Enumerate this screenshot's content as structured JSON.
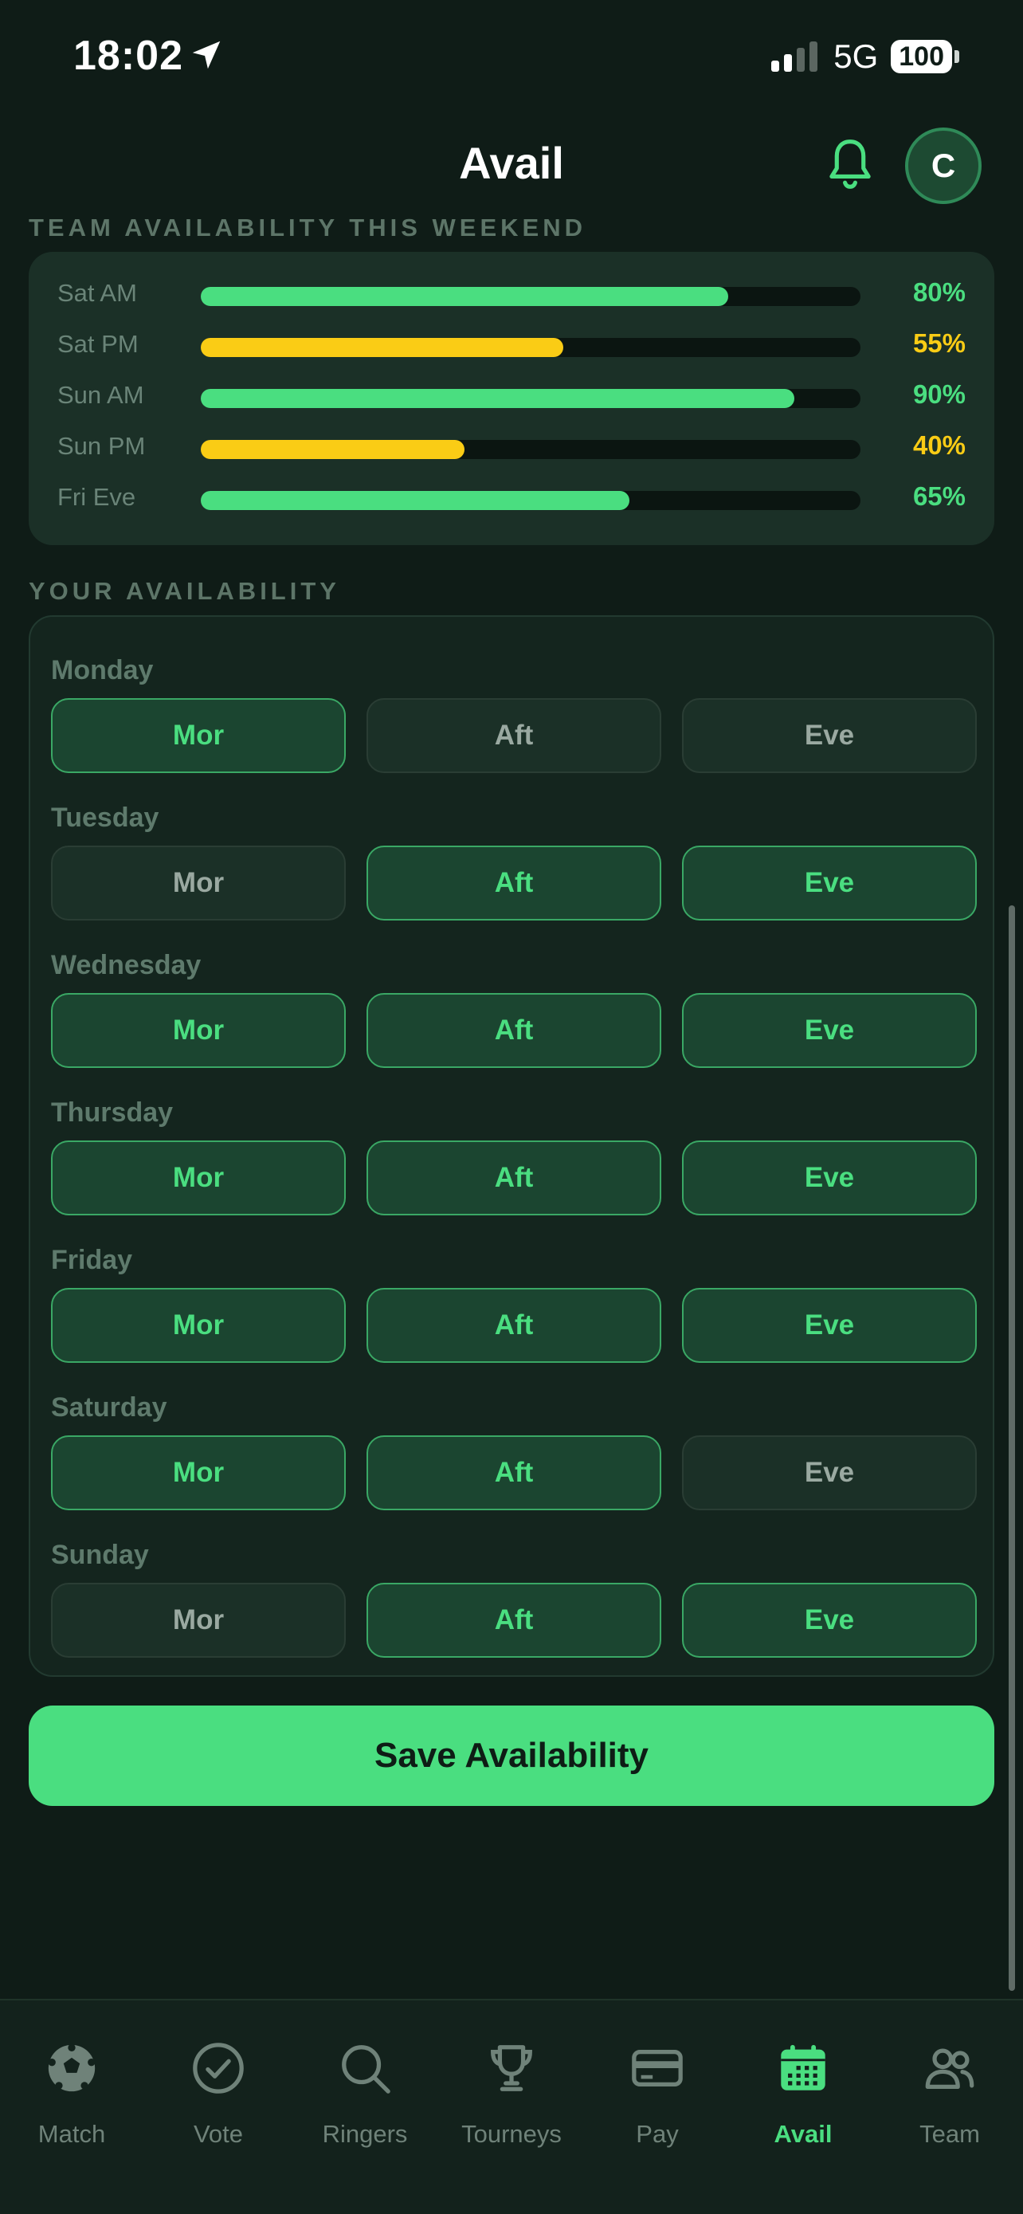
{
  "status_bar": {
    "time": "18:02",
    "network": "5G",
    "battery": "100"
  },
  "header": {
    "title": "Avail",
    "avatar_initial": "C"
  },
  "team_section": {
    "label": "TEAM AVAILABILITY THIS WEEKEND",
    "rows": [
      {
        "label": "Sat AM",
        "percent": 80,
        "percent_text": "80%",
        "color": "#4ade80"
      },
      {
        "label": "Sat PM",
        "percent": 55,
        "percent_text": "55%",
        "color": "#facc15"
      },
      {
        "label": "Sun AM",
        "percent": 90,
        "percent_text": "90%",
        "color": "#4ade80"
      },
      {
        "label": "Sun PM",
        "percent": 40,
        "percent_text": "40%",
        "color": "#facc15"
      },
      {
        "label": "Fri Eve",
        "percent": 65,
        "percent_text": "65%",
        "color": "#4ade80"
      }
    ]
  },
  "your_section": {
    "label": "YOUR AVAILABILITY",
    "days": [
      {
        "name": "Monday",
        "slots": [
          {
            "label": "Mor",
            "on": true
          },
          {
            "label": "Aft",
            "on": false
          },
          {
            "label": "Eve",
            "on": false
          }
        ]
      },
      {
        "name": "Tuesday",
        "slots": [
          {
            "label": "Mor",
            "on": false
          },
          {
            "label": "Aft",
            "on": true
          },
          {
            "label": "Eve",
            "on": true
          }
        ]
      },
      {
        "name": "Wednesday",
        "slots": [
          {
            "label": "Mor",
            "on": true
          },
          {
            "label": "Aft",
            "on": true
          },
          {
            "label": "Eve",
            "on": true
          }
        ]
      },
      {
        "name": "Thursday",
        "slots": [
          {
            "label": "Mor",
            "on": true
          },
          {
            "label": "Aft",
            "on": true
          },
          {
            "label": "Eve",
            "on": true
          }
        ]
      },
      {
        "name": "Friday",
        "slots": [
          {
            "label": "Mor",
            "on": true
          },
          {
            "label": "Aft",
            "on": true
          },
          {
            "label": "Eve",
            "on": true
          }
        ]
      },
      {
        "name": "Saturday",
        "slots": [
          {
            "label": "Mor",
            "on": true
          },
          {
            "label": "Aft",
            "on": true
          },
          {
            "label": "Eve",
            "on": false
          }
        ]
      },
      {
        "name": "Sunday",
        "slots": [
          {
            "label": "Mor",
            "on": false
          },
          {
            "label": "Aft",
            "on": true
          },
          {
            "label": "Eve",
            "on": true
          }
        ]
      }
    ]
  },
  "save_button": {
    "label": "Save Availability"
  },
  "bottom_nav": {
    "items": [
      {
        "label": "Match",
        "icon": "soccer-ball-icon",
        "active": false
      },
      {
        "label": "Vote",
        "icon": "check-circle-icon",
        "active": false
      },
      {
        "label": "Ringers",
        "icon": "search-icon",
        "active": false
      },
      {
        "label": "Tourneys",
        "icon": "trophy-icon",
        "active": false
      },
      {
        "label": "Pay",
        "icon": "credit-card-icon",
        "active": false
      },
      {
        "label": "Avail",
        "icon": "calendar-icon",
        "active": true
      },
      {
        "label": "Team",
        "icon": "users-icon",
        "active": false
      }
    ]
  },
  "colors": {
    "accent": "#4ade80",
    "warning": "#facc15",
    "background": "#0f1c17"
  }
}
